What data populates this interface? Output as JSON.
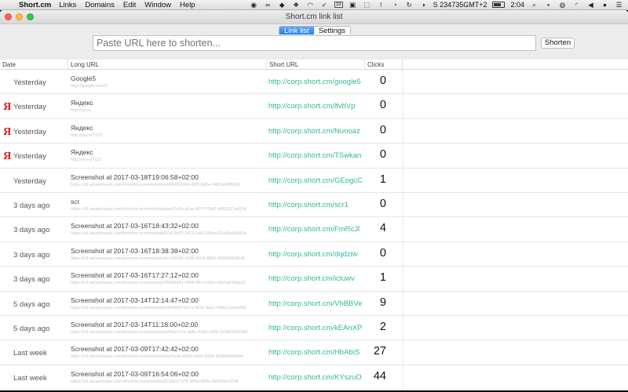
{
  "menubar": {
    "apple": "",
    "app_name": "Short.cm",
    "items": [
      "Links",
      "Domains",
      "Edit",
      "Window",
      "Help"
    ],
    "status_text": "S 234735GMT+2",
    "clock": "2:04",
    "status_icons": [
      "camera-icon",
      "link-icon",
      "tag-icon",
      "dropbox-icon",
      "ghost-icon",
      "vine-icon",
      "cal-icon",
      "app-icon",
      "shortcm-icon",
      "warning-icon",
      "gauge-icon",
      "sync-icon",
      "circle-icon",
      "battery-icon",
      "search-icon",
      "dv-icon",
      "siri-icon",
      "wifi-icon",
      "volume-icon",
      "user-icon",
      "list-icon"
    ]
  },
  "window": {
    "title": "Short.cm link list",
    "tabs": [
      {
        "label": "Link list",
        "active": true
      },
      {
        "label": "Settings",
        "active": false
      }
    ],
    "url_placeholder": "Paste URL here to shorten...",
    "shorten_label": "Shorten"
  },
  "table": {
    "headers": {
      "date": "Date",
      "long_url": "Long URL",
      "short_url": "Short URL",
      "clicks": "Clicks"
    },
    "rows": [
      {
        "source": "",
        "date": "Yesterday",
        "title": "Google5",
        "url": "http://google.com/5",
        "short": "http://corp.short.cm/google5",
        "clicks": "0"
      },
      {
        "source": "Я",
        "date": "Yesterday",
        "title": "Яндекс",
        "url": "http://ya.ru",
        "short": "http://corp.short.cm/lfvbVp",
        "clicks": "0"
      },
      {
        "source": "Я",
        "date": "Yesterday",
        "title": "Яндекс",
        "url": "http://ya.ru/?123",
        "short": "http://corp.short.cm/Nunoaz",
        "clicks": "0"
      },
      {
        "source": "Я",
        "date": "Yesterday",
        "title": "Яндекс",
        "url": "http://ya.ru/?123",
        "short": "http://corp.short.cm/TSwkan",
        "clicks": "0"
      },
      {
        "source": "",
        "date": "Yesterday",
        "title": "Screenshot at 2017-03-18T19:06:58+02:00",
        "url": "https://s3.amazonaws.com/shortcm-screenshots/ae6f605-f6bb-4f25-8d5e-3420ad0f8c8d",
        "short": "http://corp.short.cm/GEogcC",
        "clicks": "1"
      },
      {
        "source": "",
        "date": "3 days ago",
        "title": "scr",
        "url": "https://s3.amazonaws.com/shortcm-screenshots/eae81a1b-a1ac-4270-93d7-466b317ad164",
        "short": "http://corp.short.cm/scr1",
        "clicks": "0"
      },
      {
        "source": "",
        "date": "3 days ago",
        "title": "Screenshot at 2017-03-16T18:43:32+02:00",
        "url": "https://s3.amazonaws.com/shortcm-screenshots/87a23d07-2475-4a62-89dd-92a0bad5989e",
        "short": "http://corp.short.cm/FmRcJl",
        "clicks": "4"
      },
      {
        "source": "",
        "date": "3 days ago",
        "title": "Screenshot at 2017-03-16T18:38:38+02:00",
        "url": "https://s3.amazonaws.com/shortcm-screenshots/4c196049-1b06-4104-8d61-43d5fd0b8b8b",
        "short": "http://corp.short.cm/dqdziw",
        "clicks": "0"
      },
      {
        "source": "",
        "date": "3 days ago",
        "title": "Screenshot at 2017-03-16T17:27:12+02:00",
        "url": "https://s3.amazonaws.com/shortcm-screenshots/354d6241-449b-4fc1-b4eb-e6b5ab2d5a22",
        "short": "http://corp.short.cm/icluwv",
        "clicks": "1"
      },
      {
        "source": "",
        "date": "5 days ago",
        "title": "Screenshot at 2017-03-14T12:14:47+02:00",
        "url": "https://s3.amazonaws.com/shortcm-screenshots/e3e9f6b9-0a7a-452e-9ae1-0f6bc1bca6d56",
        "short": "http://corp.short.cm/VhBBVe",
        "clicks": "9"
      },
      {
        "source": "",
        "date": "5 days ago",
        "title": "Screenshot at 2017-03-14T11:18:00+02:00",
        "url": "https://s3.amazonaws.com/shortcm-screenshots/e26ab7c7a-3b8c-43e0-a305-419852d5b3f9",
        "short": "http://corp.short.cm/kEAnXP",
        "clicks": "2"
      },
      {
        "source": "",
        "date": "Last week",
        "title": "Screenshot at 2017-03-09T17:42:42+02:00",
        "url": "https://s3.amazonaws.com/shortcm-screenshots/ba21edd-a3d0-4dde-8369-26485b6d58fd",
        "short": "http://corp.short.cm/HbAbiS",
        "clicks": "27"
      },
      {
        "source": "",
        "date": "Last week",
        "title": "Screenshot at 2017-03-09T16:54:06+02:00",
        "url": "https://s3.amazonaws.com/shortcm-screenshots/0c98b1f-07ff-44b6-968a-5fe363e1014f",
        "short": "http://corp.short.cm/KYszuO",
        "clicks": "44"
      }
    ]
  }
}
